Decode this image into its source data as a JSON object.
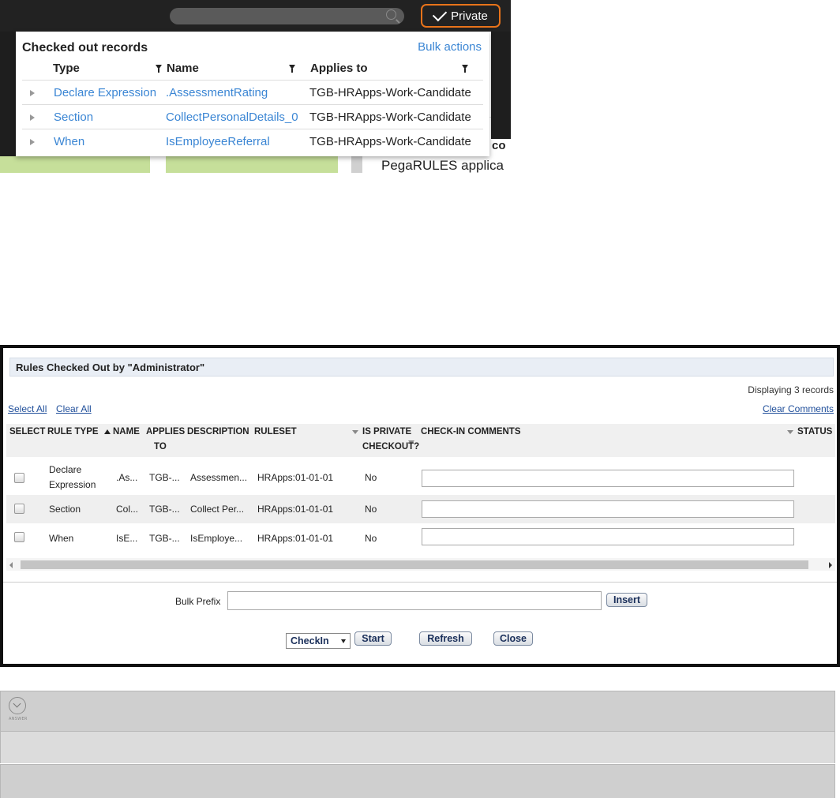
{
  "top_panel": {
    "private_button": "Private",
    "popover_title": "Checked out records",
    "bulk_actions": "Bulk actions",
    "columns": [
      "Type",
      "Name",
      "Applies to"
    ],
    "rows": [
      {
        "type": "Declare Expression",
        "name": ".AssessmentRating",
        "applies_to": "TGB-HRApps-Work-Candidate"
      },
      {
        "type": "Section",
        "name": "CollectPersonalDetails_0",
        "applies_to": "TGB-HRApps-Work-Candidate"
      },
      {
        "type": "When",
        "name": "IsEmployeeReferral",
        "applies_to": "TGB-HRApps-Work-Candidate"
      }
    ],
    "background_text_1": "co",
    "background_text_2": "PegaRULES applica"
  },
  "dialog": {
    "title": "Rules Checked Out by \"Administrator\"",
    "displaying": "Displaying 3 records",
    "select_all": "Select All",
    "clear_all": "Clear All",
    "clear_comments": "Clear Comments",
    "headers": {
      "select": "SELECT",
      "rule_type": "RULE TYPE",
      "name": "NAME",
      "applies_to_1": "APPLIES",
      "applies_to_2": "TO",
      "description": "DESCRIPTION",
      "ruleset": "RULESET",
      "is_private_1": "IS PRIVATE",
      "is_private_2": "CHECKOUT?",
      "check_in_comments": "CHECK-IN COMMENTS",
      "status": "STATUS"
    },
    "rows": [
      {
        "rule_type_1": "Declare",
        "rule_type_2": "Expression",
        "name": ".As...",
        "applies_to": "TGB-...",
        "description": "Assessmen...",
        "ruleset": "HRApps:01-01-01",
        "is_private": "No"
      },
      {
        "rule_type_1": "Section",
        "rule_type_2": "",
        "name": "Col...",
        "applies_to": "TGB-...",
        "description": "Collect Per...",
        "ruleset": "HRApps:01-01-01",
        "is_private": "No"
      },
      {
        "rule_type_1": "When",
        "rule_type_2": "",
        "name": "IsE...",
        "applies_to": "TGB-...",
        "description": "IsEmploye...",
        "ruleset": "HRApps:01-01-01",
        "is_private": "No"
      }
    ],
    "bulk_prefix_label": "Bulk Prefix",
    "insert_button": "Insert",
    "action_select": "CheckIn",
    "start_button": "Start",
    "refresh_button": "Refresh",
    "close_button": "Close"
  },
  "answer": {
    "label": "ANSWER"
  }
}
